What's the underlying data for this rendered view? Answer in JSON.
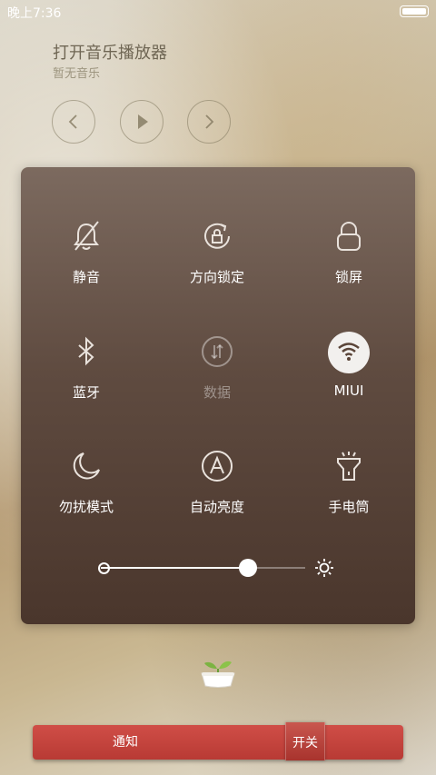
{
  "status_bar": {
    "time": "晚上7:36"
  },
  "music": {
    "title": "打开音乐播放器",
    "subtitle": "暂无音乐",
    "controls": [
      "previous-icon",
      "play-icon",
      "next-icon"
    ]
  },
  "toggles": [
    {
      "label": "静音",
      "icon": "bell-off-icon",
      "state": "off"
    },
    {
      "label": "方向锁定",
      "icon": "rotation-lock-icon",
      "state": "off"
    },
    {
      "label": "锁屏",
      "icon": "lock-icon",
      "state": "off"
    },
    {
      "label": "蓝牙",
      "icon": "bluetooth-icon",
      "state": "off"
    },
    {
      "label": "数据",
      "icon": "mobile-data-icon",
      "state": "disabled"
    },
    {
      "label": "MIUI",
      "icon": "wifi-icon",
      "state": "on"
    },
    {
      "label": "勿扰模式",
      "icon": "moon-icon",
      "state": "off"
    },
    {
      "label": "自动亮度",
      "icon": "auto-brightness-icon",
      "state": "off"
    },
    {
      "label": "手电筒",
      "icon": "flashlight-icon",
      "state": "off"
    }
  ],
  "brightness": {
    "level": 0.72
  },
  "tabs": {
    "notify": "通知",
    "switches": "开关"
  },
  "colors": {
    "panel": "#5f4b40",
    "tab_bar": "#c1423c",
    "wifi_active": "#f2f0ee"
  }
}
